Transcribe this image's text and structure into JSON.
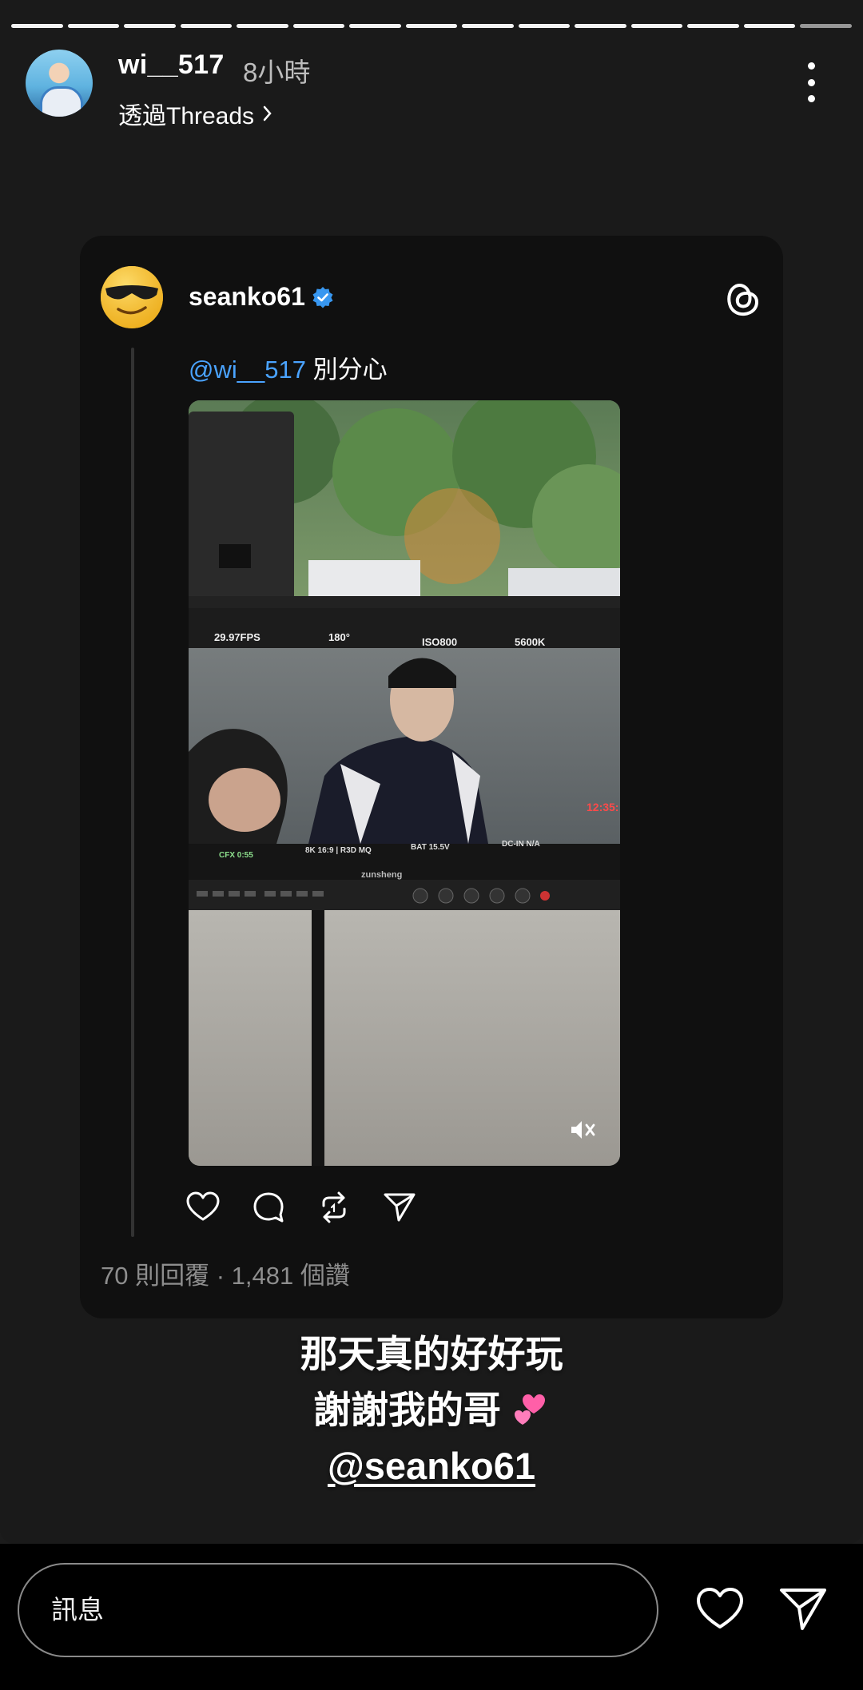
{
  "story": {
    "segments": 15,
    "username": "wi__517",
    "time": "8小時",
    "via": "透過Threads"
  },
  "post": {
    "author": "seanko61",
    "verified": true,
    "reply_mention": "@wi__517",
    "reply_text": " 別分心",
    "stats": "70 則回覆 · 1,481 個讚",
    "monitor": {
      "fps": "29.97FPS",
      "shutter": "180°",
      "iso": "ISO800",
      "wb": "5600K",
      "cfx": "CFX 0:55",
      "format": "8K 16:9 | R3D MQ",
      "bat": "BAT 15.5V",
      "dcin": "DC-IN N/A",
      "tc": "12:35:",
      "brand": "zunsheng"
    }
  },
  "caption": {
    "line1": "那天真的好好玩",
    "line2": "謝謝我的哥",
    "mention": "@seanko61"
  },
  "bottom": {
    "message_placeholder": "訊息"
  },
  "colors": {
    "mention": "#4aa3ff",
    "verified": "#3897f0",
    "timecode": "#ff4a4a"
  }
}
